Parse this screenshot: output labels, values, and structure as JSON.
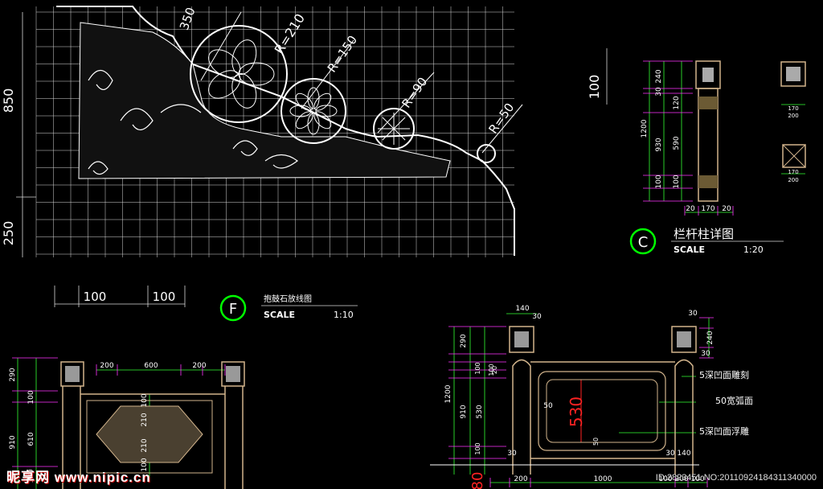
{
  "colors": {
    "background": "#000000",
    "grid": "#d9d9d9",
    "geometry": "#ffffff",
    "dimension": "#33ff33",
    "ext": "#ff33ff",
    "column": "#d2b48c",
    "title_circle": "#00ff00",
    "red": "#ff2222"
  },
  "detail_f": {
    "radius_labels": [
      "R=210",
      "R=150",
      "R=90",
      "R=50"
    ],
    "top_dim": "350",
    "left_dims": [
      "850",
      "250"
    ],
    "right_dim": "100",
    "bottom_dims": [
      "100",
      "100"
    ],
    "title_letter": "F",
    "title": "抱鼓石放线图",
    "scale_label": "SCALE",
    "scale_value": "1:10"
  },
  "detail_c": {
    "left_total": "1200",
    "left_dims": [
      "930",
      "240",
      "30",
      "120",
      "590",
      "100",
      "100"
    ],
    "bottom_dims": [
      "20",
      "170",
      "20"
    ],
    "small_dims": [
      "170",
      "200"
    ],
    "title_letter": "C",
    "title": "栏杆柱详图",
    "scale_label": "SCALE",
    "scale_value": "1:20"
  },
  "panel_left": {
    "top_dims": [
      "200",
      "600",
      "200"
    ],
    "left_dims": [
      "290",
      "910",
      "100",
      "610",
      "100"
    ],
    "center_dims": [
      "100",
      "210",
      "210",
      "100"
    ]
  },
  "panel_right": {
    "top_dims": [
      "140",
      "30"
    ],
    "left_dims": [
      "1200",
      "290",
      "910",
      "100",
      "100",
      "530",
      "100"
    ],
    "right_dims": [
      "30",
      "240",
      "30"
    ],
    "inner_dims": [
      "20",
      "50",
      "50",
      "30",
      "30",
      "140"
    ],
    "center_dim": "530",
    "bottom_dims": [
      "200",
      "1000",
      "100",
      "200",
      "100"
    ],
    "notes": [
      "5深凹面雕刻",
      "50宽弧面",
      "5深凹面浮雕"
    ],
    "red_dim": "80"
  },
  "watermark": {
    "text": "昵享网 www.nipic.cn",
    "id": "ID:2823451 NO:20110924184311340000"
  }
}
